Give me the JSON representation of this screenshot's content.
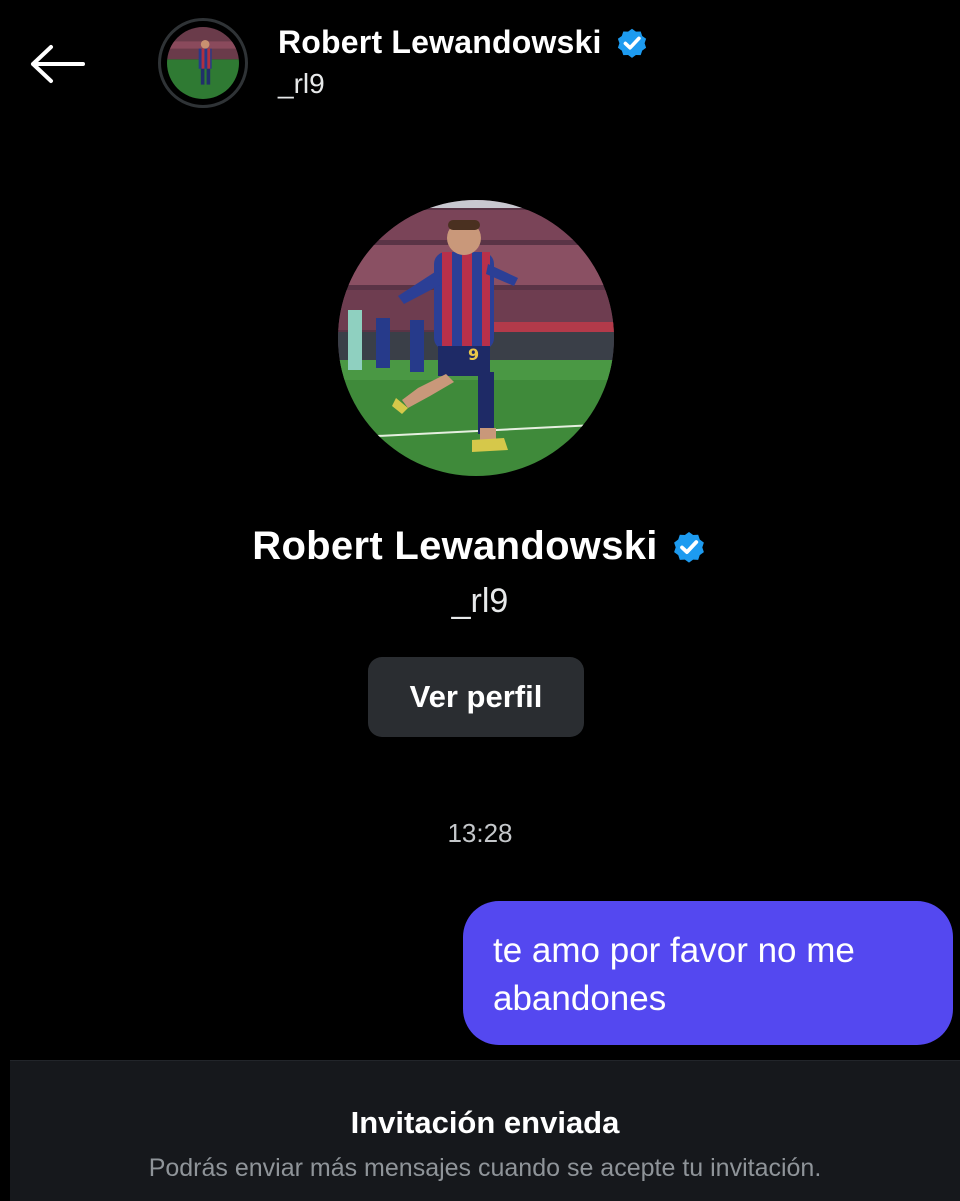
{
  "header": {
    "name": "Robert Lewandowski",
    "handle": "_rl9",
    "back_icon": "arrow-left-icon",
    "verified_icon": "verified-badge-icon"
  },
  "profile": {
    "name": "Robert Lewandowski",
    "handle": "_rl9",
    "view_profile_label": "Ver perfil",
    "verified_icon": "verified-badge-icon"
  },
  "conversation": {
    "timestamp": "13:28",
    "messages": [
      {
        "sender": "me",
        "text": "te amo por favor no me abandones"
      }
    ]
  },
  "footer": {
    "title": "Invitación enviada",
    "subtitle": "Podrás enviar más mensajes cuando se acepte tu invitación."
  },
  "colors": {
    "background": "#000000",
    "bubble": "#5448f0",
    "verified": "#1d9bf0",
    "button": "#2a2d31",
    "footer": "#16181c",
    "muted_text": "#8f9499"
  }
}
